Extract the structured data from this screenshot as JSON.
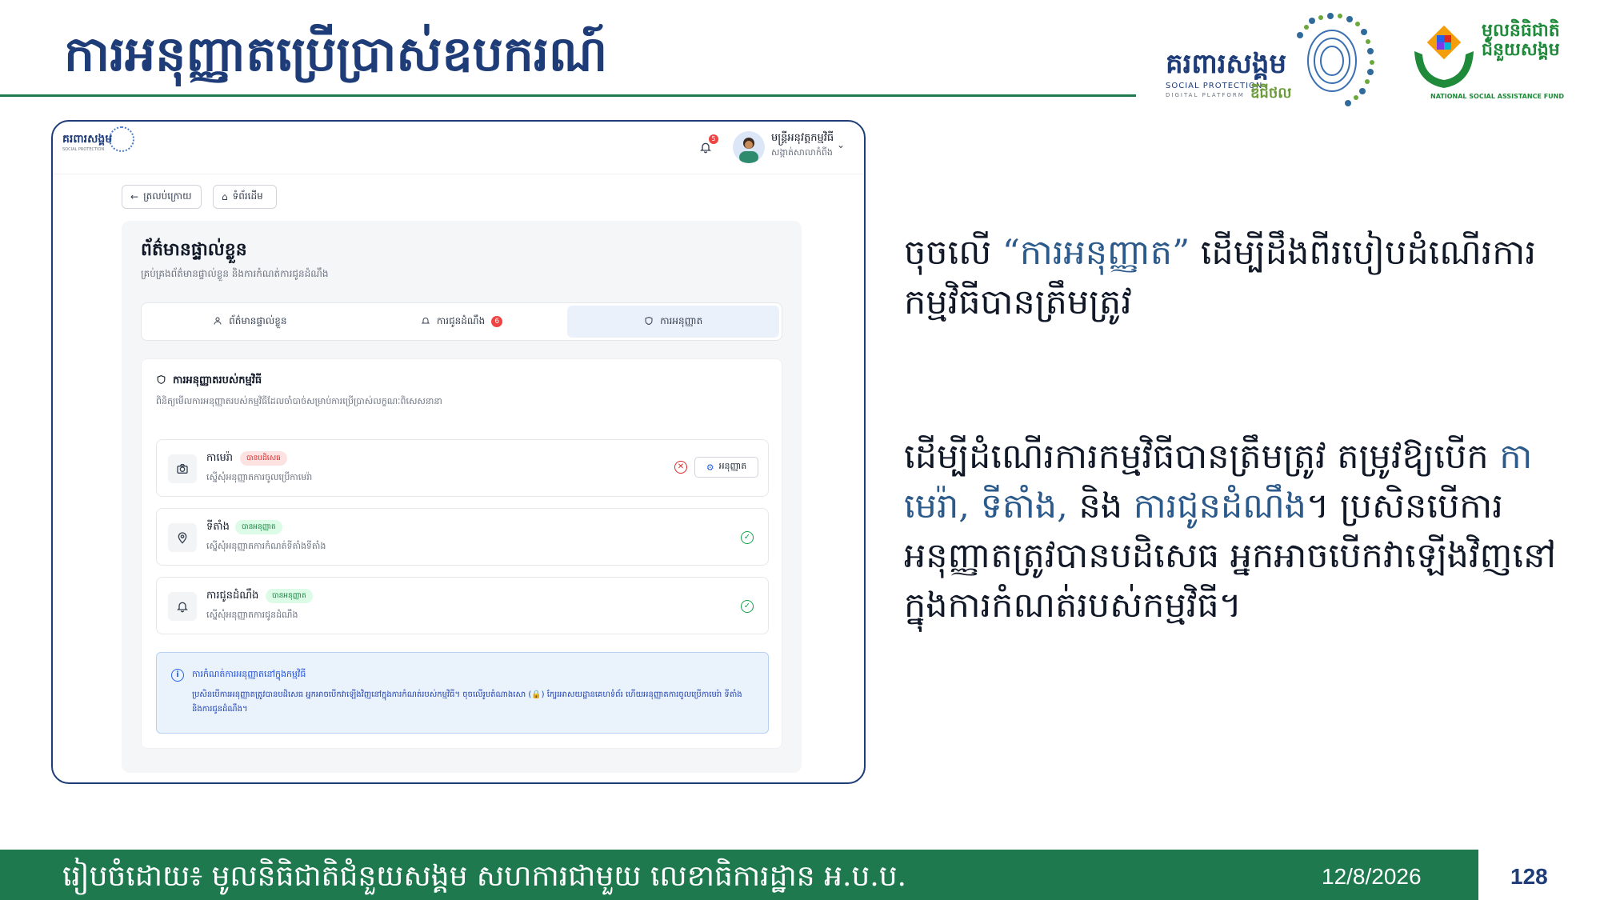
{
  "slide": {
    "title": "ការអនុញ្ញាតប្រើប្រាស់ឧបករណ៍",
    "logos": {
      "social_protection": {
        "name": "គរពារសង្គម",
        "line1": "SOCIAL PROTECTION",
        "line2": "DIGITAL PLATFORM",
        "short": "ឌីជីថល"
      },
      "nsaf": {
        "name": "មូលនិធិជាតិជំនួយសង្គម",
        "english": "NATIONAL SOCIAL ASSISTANCE FUND"
      }
    },
    "paragraph1": {
      "before": "ចុចលើ ",
      "highlight": "“ការអនុញ្ញាត”",
      "after": " ដើម្បីដឹងពីរបៀបដំណើរការកម្មវិធីបានត្រឹមត្រូវ"
    },
    "paragraph2": {
      "part1": "ដើម្បីដំណើរការកម្មវិធីបានត្រឹមត្រូវ តម្រូវឱ្យបើក ",
      "hl1": "កាមេរ៉ា, ទីតាំង,",
      "part2": " និង ",
      "hl2": "ការជូនដំណឹង",
      "part3": "។ ប្រសិនបើការអនុញ្ញាតត្រូវបានបដិសេធ អ្នកអាចបើកវាឡើងវិញនៅក្នុងការកំណត់របស់កម្មវិធី។"
    },
    "footer": {
      "text": "រៀបចំដោយ៖ មូលនិធិជាតិជំនួយសង្គម សហការជាមួយ លេខាធិការដ្ឋាន អ.ប.ប.",
      "date": "12/8/2026",
      "page": "128"
    },
    "colors": {
      "title": "#1d3c78",
      "accent_green": "#1e7a4e",
      "highlight": "#2c5a8a"
    }
  },
  "app": {
    "logo": {
      "name": "គរពារសង្គម",
      "sub": "SOCIAL PROTECTION"
    },
    "notifications_count": "5",
    "user": {
      "name": "មន្ត្រីអនុវត្តកម្មវិធី",
      "role": "សង្កាត់សាលាកំពីង"
    },
    "nav": {
      "back_label": "ត្រលប់ក្រោយ",
      "home_label": "ទំព័រដើម"
    },
    "panel": {
      "title": "ព័ត៌មានផ្ទាល់ខ្លួន",
      "subtitle": "គ្រប់គ្រងព័ត៌មានផ្ទាល់ខ្លួន និងការកំណត់ការជូនដំណឹង",
      "tabs": [
        {
          "label": "ព័ត៌មានផ្ទាល់ខ្លួន",
          "icon": "user-icon"
        },
        {
          "label": "ការជូនដំណឹង",
          "icon": "bell-icon",
          "badge": "6"
        },
        {
          "label": "ការអនុញ្ញាត",
          "icon": "shield-icon",
          "active": true
        }
      ]
    },
    "permissions": {
      "heading": "ការអនុញ្ញាតរបស់កម្មវិធី",
      "description": "ពិនិត្យមើលការអនុញ្ញាតរបស់កម្មវិធីដែលចាំបាច់សម្រាប់ការប្រើប្រាស់លក្ខណៈពិសេសនានា",
      "items": [
        {
          "name": "កាមេរ៉ា",
          "status": "បានបដិសេធ",
          "status_type": "denied",
          "description": "ស្នើសុំអនុញ្ញាតការចូលប្រើកាមេរ៉ា",
          "action_label": "អនុញ្ញាត",
          "icon": "camera-icon"
        },
        {
          "name": "ទីតាំង",
          "status": "បានអនុញ្ញាត",
          "status_type": "allowed",
          "description": "ស្នើសុំអនុញ្ញាតការកំណត់ទីតាំងទីតាំង",
          "icon": "location-pin-icon"
        },
        {
          "name": "ការជូនដំណឹង",
          "status": "បានអនុញ្ញាត",
          "status_type": "allowed",
          "description": "ស្នើសុំអនុញ្ញាតការជូនដំណឹង",
          "icon": "bell-icon"
        }
      ],
      "info": {
        "title": "ការកំណត់ការអនុញ្ញាតនៅក្នុងកម្មវិធី",
        "text": "ប្រសិនបើការអនុញ្ញាតត្រូវបានបដិសេធ អ្នកអាចបើកវាឡើងវិញនៅក្នុងការកំណត់របស់កម្មវិធី។ ចុចលើរូបតំណាងសោ (🔒) ក្បែរអាសយដ្ឋានគេហទំព័រ ហើយអនុញ្ញាតការចូលប្រើកាមេរ៉ា ទីតាំង និងការជូនដំណឹង។"
      }
    }
  }
}
